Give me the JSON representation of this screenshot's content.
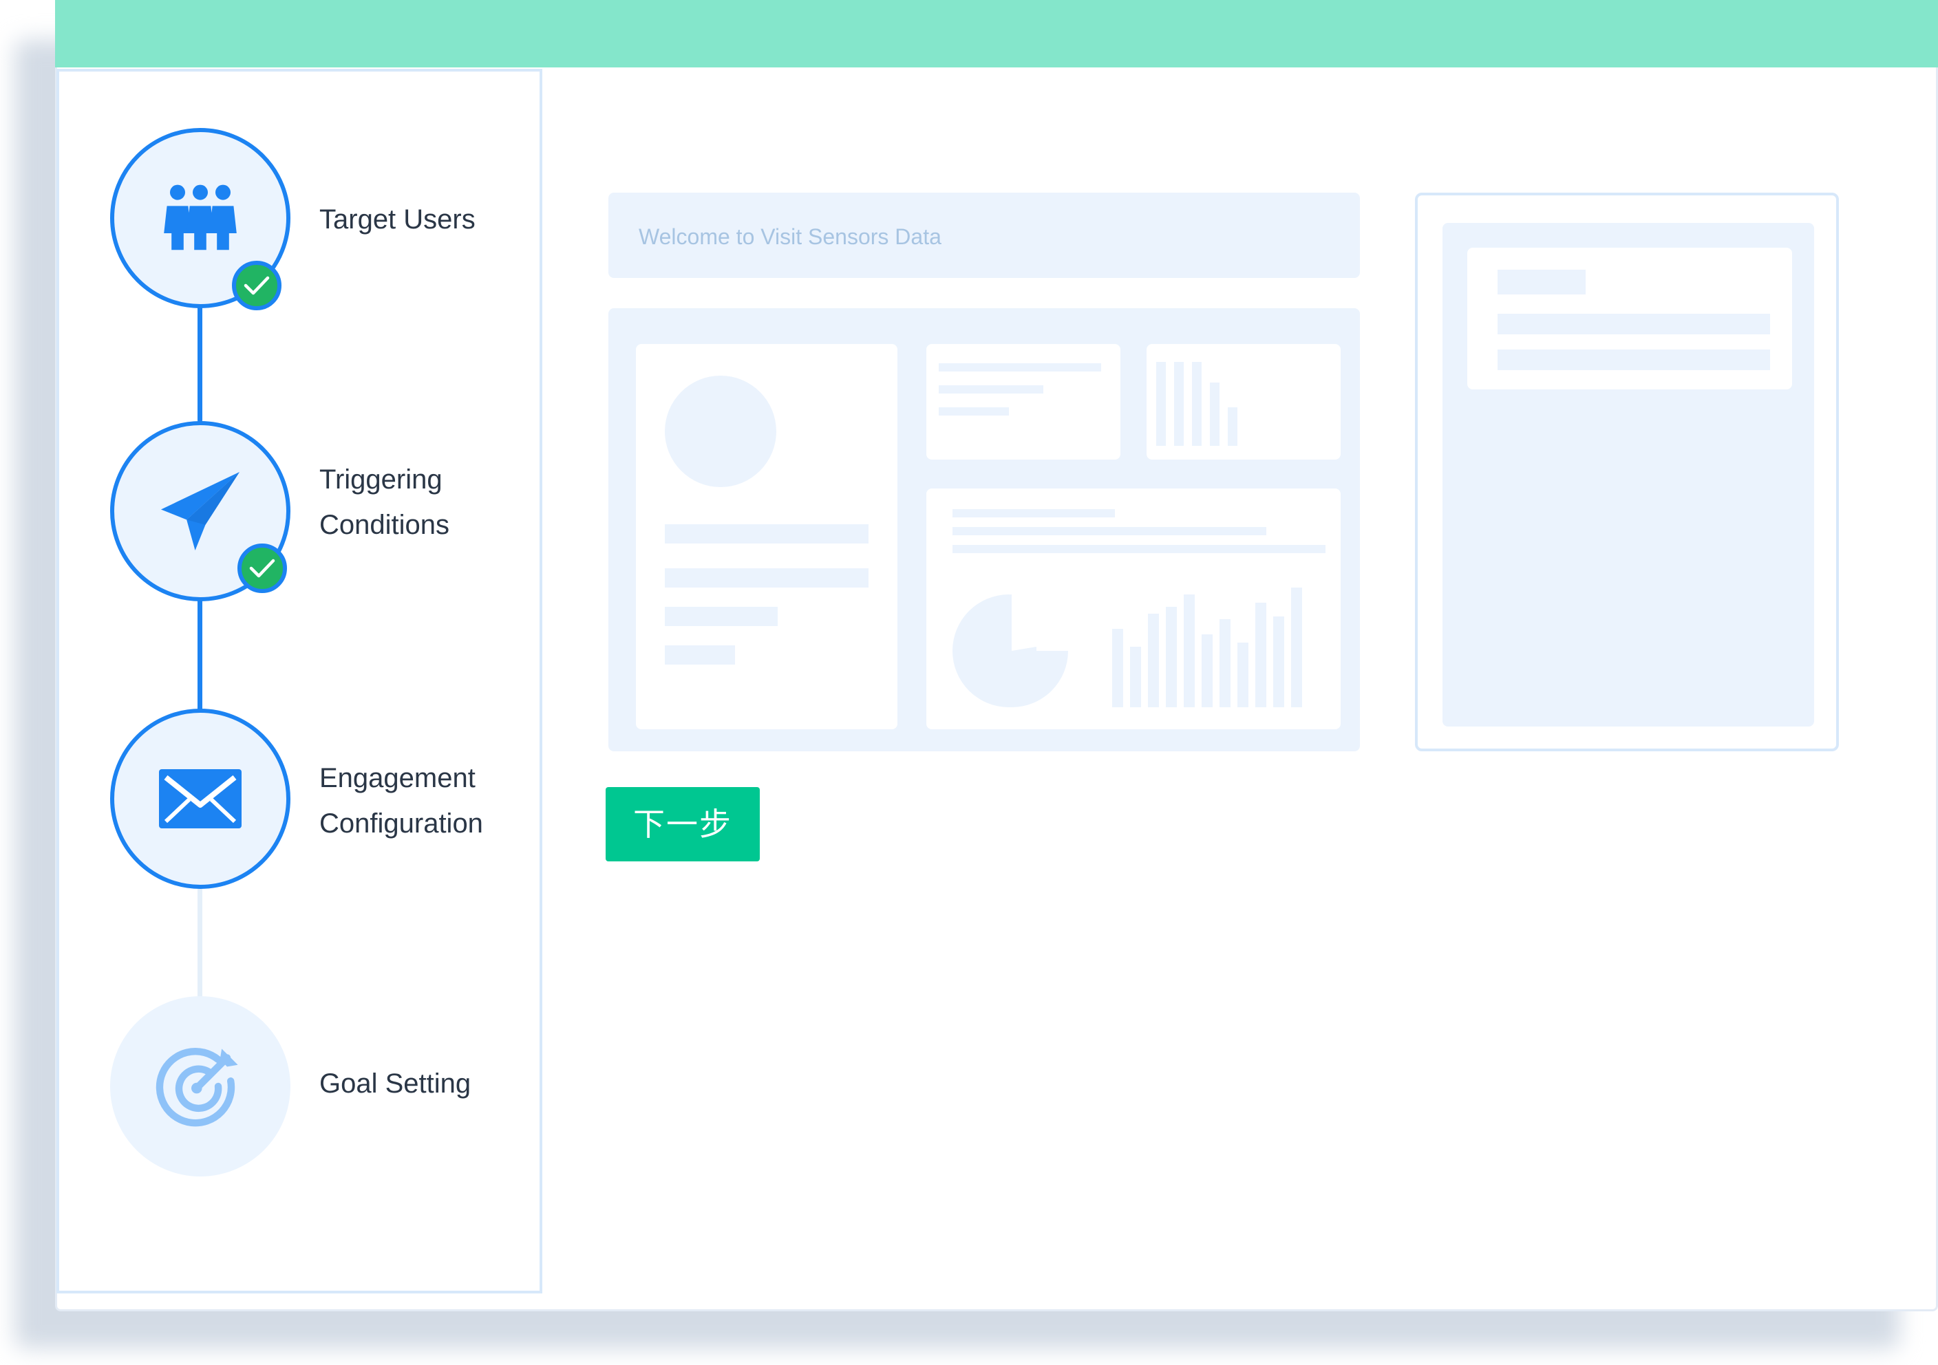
{
  "steps": [
    {
      "label_lines": [
        "Target Users"
      ],
      "state": "completed",
      "icon": "users-group-icon"
    },
    {
      "label_lines": [
        "Triggering",
        "Conditions"
      ],
      "state": "completed",
      "icon": "paper-plane-icon"
    },
    {
      "label_lines": [
        "Engagement",
        "Configuration"
      ],
      "state": "current",
      "icon": "envelope-icon"
    },
    {
      "label_lines": [
        "Goal Setting"
      ],
      "state": "pending",
      "icon": "target-arrow-icon"
    }
  ],
  "preview": {
    "welcome_text": "Welcome to Visit Sensors Data"
  },
  "next_button_label": "下一步",
  "colors": {
    "top_bar": "#84e6cb",
    "accent_blue": "#1c83f2",
    "check_green": "#21b463",
    "button_green": "#00c791",
    "placeholder": "#ebf3fd"
  }
}
